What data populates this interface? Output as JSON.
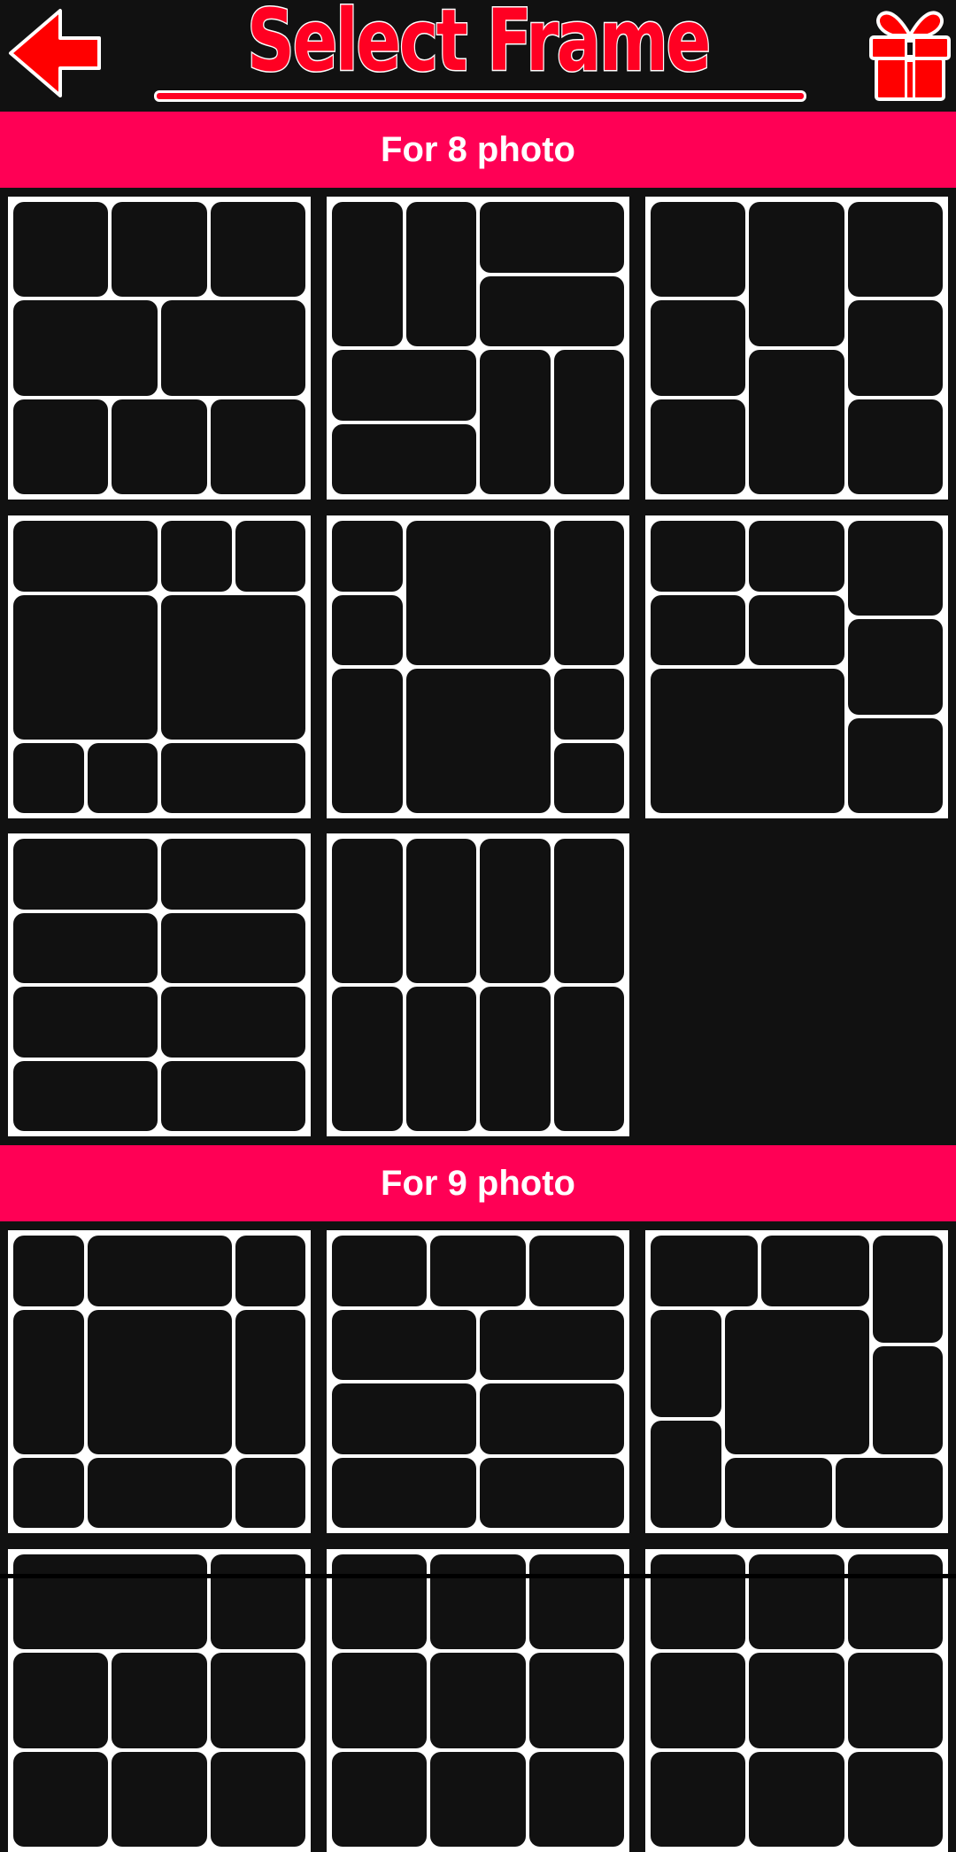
{
  "header": {
    "title": "Select Frame",
    "back_icon": "arrow-left-icon",
    "gift_icon": "gift-icon",
    "accent_color": "#ff0022"
  },
  "theme": {
    "background": "#111111",
    "section_color": "#ff0055",
    "frame_border_color": "#ffffff",
    "cell_color": "#111111"
  },
  "grid_units": 24,
  "sections": [
    {
      "label": "For 8 photo",
      "frames": [
        {
          "name": "frame-8-1",
          "cells": [
            [
              0,
              0,
              8,
              8
            ],
            [
              8,
              0,
              8,
              8
            ],
            [
              16,
              0,
              8,
              8
            ],
            [
              0,
              8,
              12,
              8
            ],
            [
              12,
              8,
              12,
              8
            ],
            [
              0,
              16,
              8,
              8
            ],
            [
              8,
              16,
              8,
              8
            ],
            [
              16,
              16,
              8,
              8
            ]
          ]
        },
        {
          "name": "frame-8-2",
          "cells": [
            [
              0,
              0,
              6,
              12
            ],
            [
              6,
              0,
              6,
              12
            ],
            [
              12,
              0,
              12,
              6
            ],
            [
              12,
              6,
              12,
              6
            ],
            [
              0,
              12,
              12,
              6
            ],
            [
              0,
              18,
              12,
              6
            ],
            [
              12,
              12,
              6,
              12
            ],
            [
              18,
              12,
              6,
              12
            ]
          ]
        },
        {
          "name": "frame-8-3",
          "cells": [
            [
              0,
              0,
              8,
              8
            ],
            [
              0,
              8,
              8,
              8
            ],
            [
              0,
              16,
              8,
              8
            ],
            [
              8,
              0,
              8,
              12
            ],
            [
              8,
              12,
              8,
              12
            ],
            [
              16,
              0,
              8,
              8
            ],
            [
              16,
              8,
              8,
              8
            ],
            [
              16,
              16,
              8,
              8
            ]
          ]
        },
        {
          "name": "frame-8-4",
          "cells": [
            [
              0,
              0,
              12,
              6
            ],
            [
              12,
              0,
              6,
              6
            ],
            [
              18,
              0,
              6,
              6
            ],
            [
              0,
              6,
              12,
              12
            ],
            [
              12,
              6,
              12,
              12
            ],
            [
              0,
              18,
              6,
              6
            ],
            [
              6,
              18,
              6,
              6
            ],
            [
              12,
              18,
              12,
              6
            ]
          ]
        },
        {
          "name": "frame-8-5",
          "cells": [
            [
              0,
              0,
              6,
              6
            ],
            [
              0,
              6,
              6,
              6
            ],
            [
              6,
              0,
              12,
              12
            ],
            [
              18,
              0,
              6,
              12
            ],
            [
              0,
              12,
              6,
              12
            ],
            [
              6,
              12,
              12,
              12
            ],
            [
              18,
              12,
              6,
              6
            ],
            [
              18,
              18,
              6,
              6
            ]
          ]
        },
        {
          "name": "frame-8-6",
          "cells": [
            [
              0,
              0,
              8,
              6
            ],
            [
              8,
              0,
              8,
              6
            ],
            [
              0,
              6,
              8,
              6
            ],
            [
              8,
              6,
              8,
              6
            ],
            [
              0,
              12,
              16,
              12
            ],
            [
              16,
              0,
              8,
              8
            ],
            [
              16,
              8,
              8,
              8
            ],
            [
              16,
              16,
              8,
              8
            ]
          ]
        },
        {
          "name": "frame-8-7",
          "cells": [
            [
              0,
              0,
              12,
              6
            ],
            [
              12,
              0,
              12,
              6
            ],
            [
              0,
              6,
              12,
              6
            ],
            [
              12,
              6,
              12,
              6
            ],
            [
              0,
              12,
              12,
              6
            ],
            [
              12,
              12,
              12,
              6
            ],
            [
              0,
              18,
              12,
              6
            ],
            [
              12,
              18,
              12,
              6
            ]
          ]
        },
        {
          "name": "frame-8-8",
          "cells": [
            [
              0,
              0,
              6,
              12
            ],
            [
              6,
              0,
              6,
              12
            ],
            [
              12,
              0,
              6,
              12
            ],
            [
              18,
              0,
              6,
              12
            ],
            [
              0,
              12,
              6,
              12
            ],
            [
              6,
              12,
              6,
              12
            ],
            [
              12,
              12,
              6,
              12
            ],
            [
              18,
              12,
              6,
              12
            ]
          ]
        }
      ]
    },
    {
      "label": "For 9 photo",
      "frames": [
        {
          "name": "frame-9-1",
          "cells": [
            [
              0,
              0,
              6,
              6
            ],
            [
              6,
              0,
              12,
              6
            ],
            [
              18,
              0,
              6,
              6
            ],
            [
              0,
              6,
              6,
              12
            ],
            [
              6,
              6,
              12,
              12
            ],
            [
              18,
              6,
              6,
              12
            ],
            [
              0,
              18,
              6,
              6
            ],
            [
              6,
              18,
              12,
              6
            ],
            [
              18,
              18,
              6,
              6
            ]
          ]
        },
        {
          "name": "frame-9-2",
          "cells": [
            [
              0,
              0,
              8,
              6
            ],
            [
              8,
              0,
              8,
              6
            ],
            [
              16,
              0,
              8,
              6
            ],
            [
              0,
              6,
              12,
              6
            ],
            [
              12,
              6,
              12,
              6
            ],
            [
              0,
              12,
              12,
              6
            ],
            [
              12,
              12,
              12,
              6
            ],
            [
              0,
              18,
              12,
              6
            ],
            [
              12,
              18,
              12,
              6
            ]
          ]
        },
        {
          "name": "frame-9-3",
          "cells": [
            [
              0,
              0,
              9,
              6
            ],
            [
              9,
              0,
              9,
              6
            ],
            [
              18,
              0,
              6,
              9
            ],
            [
              18,
              9,
              6,
              9
            ],
            [
              0,
              6,
              6,
              9
            ],
            [
              0,
              15,
              6,
              9
            ],
            [
              6,
              6,
              12,
              12
            ],
            [
              6,
              18,
              9,
              6
            ],
            [
              15,
              18,
              9,
              6
            ]
          ]
        },
        {
          "name": "frame-9-4",
          "cells": [
            [
              0,
              0,
              16,
              8
            ],
            [
              16,
              0,
              8,
              8
            ],
            [
              0,
              8,
              8,
              8
            ],
            [
              8,
              8,
              8,
              8
            ],
            [
              16,
              8,
              8,
              8
            ],
            [
              0,
              16,
              8,
              8
            ],
            [
              8,
              16,
              8,
              8
            ],
            [
              16,
              16,
              8,
              8
            ]
          ]
        },
        {
          "name": "frame-9-5",
          "cells": [
            [
              0,
              0,
              8,
              8
            ],
            [
              8,
              0,
              8,
              8
            ],
            [
              16,
              0,
              8,
              8
            ],
            [
              0,
              8,
              8,
              8
            ],
            [
              8,
              8,
              8,
              8
            ],
            [
              16,
              8,
              8,
              8
            ],
            [
              0,
              16,
              8,
              8
            ],
            [
              8,
              16,
              8,
              8
            ],
            [
              16,
              16,
              8,
              8
            ]
          ]
        },
        {
          "name": "frame-9-6",
          "cells": [
            [
              0,
              0,
              8,
              8
            ],
            [
              8,
              0,
              8,
              8
            ],
            [
              16,
              0,
              8,
              8
            ],
            [
              0,
              8,
              8,
              8
            ],
            [
              8,
              8,
              8,
              8
            ],
            [
              16,
              8,
              8,
              8
            ],
            [
              0,
              16,
              8,
              8
            ],
            [
              8,
              16,
              8,
              8
            ],
            [
              16,
              16,
              8,
              8
            ]
          ]
        }
      ]
    }
  ]
}
